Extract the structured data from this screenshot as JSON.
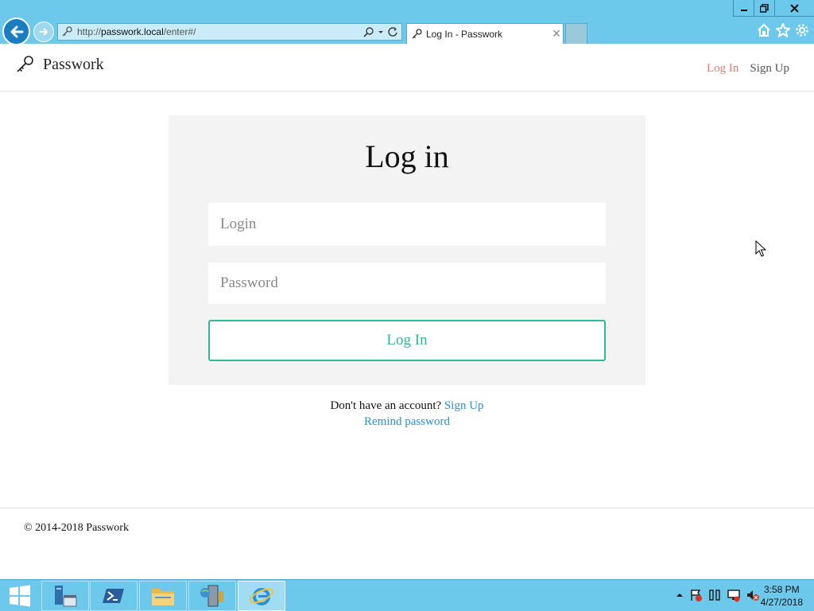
{
  "browser": {
    "url_prefix": "http://",
    "url_host": "passwork.local",
    "url_path": "/enter#/",
    "tab_title": "Log In - Passwork",
    "tab_close": "✕"
  },
  "header": {
    "brand": "Passwork",
    "nav": {
      "login": "Log In",
      "signup": "Sign Up"
    }
  },
  "form": {
    "title": "Log in",
    "login_placeholder": "Login",
    "password_placeholder": "Password",
    "submit_label": "Log In"
  },
  "below": {
    "no_account_text": "Don't have an account?",
    "signup_link": "Sign Up",
    "remind_link": "Remind password"
  },
  "footer": {
    "copyright": "© 2014-2018 Passwork"
  },
  "taskbar": {
    "time": "3:58 PM",
    "date": "4/27/2018"
  },
  "colors": {
    "accent": "#2fb896",
    "nav_active": "#e8796f",
    "link": "#2b8fd6",
    "chrome": "#6dc9ec"
  }
}
